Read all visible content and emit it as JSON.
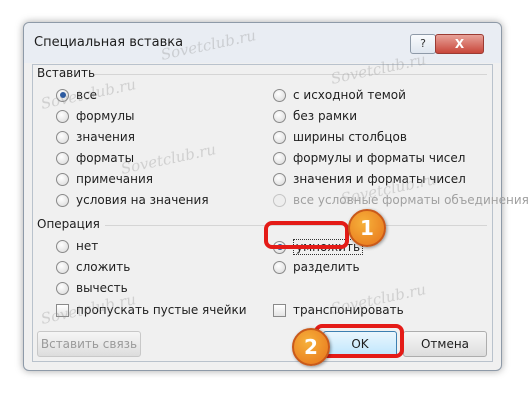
{
  "dialog": {
    "title": "Специальная вставка",
    "help_label": "?",
    "close_label": "X"
  },
  "paste_group": {
    "label": "Вставить",
    "left_options": [
      "все",
      "формулы",
      "значения",
      "форматы",
      "примечания",
      "условия на значения"
    ],
    "right_options": [
      "с исходной темой",
      "без рамки",
      "ширины столбцов",
      "формулы и форматы чисел",
      "значения и форматы чисел",
      "все условные форматы объединения"
    ],
    "selected": "все"
  },
  "operation_group": {
    "label": "Операция",
    "left_options": [
      "нет",
      "сложить",
      "вычесть"
    ],
    "right_options": [
      "умножить",
      "разделить"
    ],
    "selected": "умножить"
  },
  "checkboxes": {
    "skip_blanks": "пропускать пустые ячейки",
    "transpose": "транспонировать"
  },
  "buttons": {
    "paste_link": "Вставить связь",
    "ok": "OK",
    "cancel": "Отмена"
  },
  "annotations": {
    "badge1": "1",
    "badge2": "2"
  },
  "watermark": "Sovetclub.ru",
  "colors": {
    "highlight": "#e41b17",
    "badge": "#f09a2a"
  }
}
